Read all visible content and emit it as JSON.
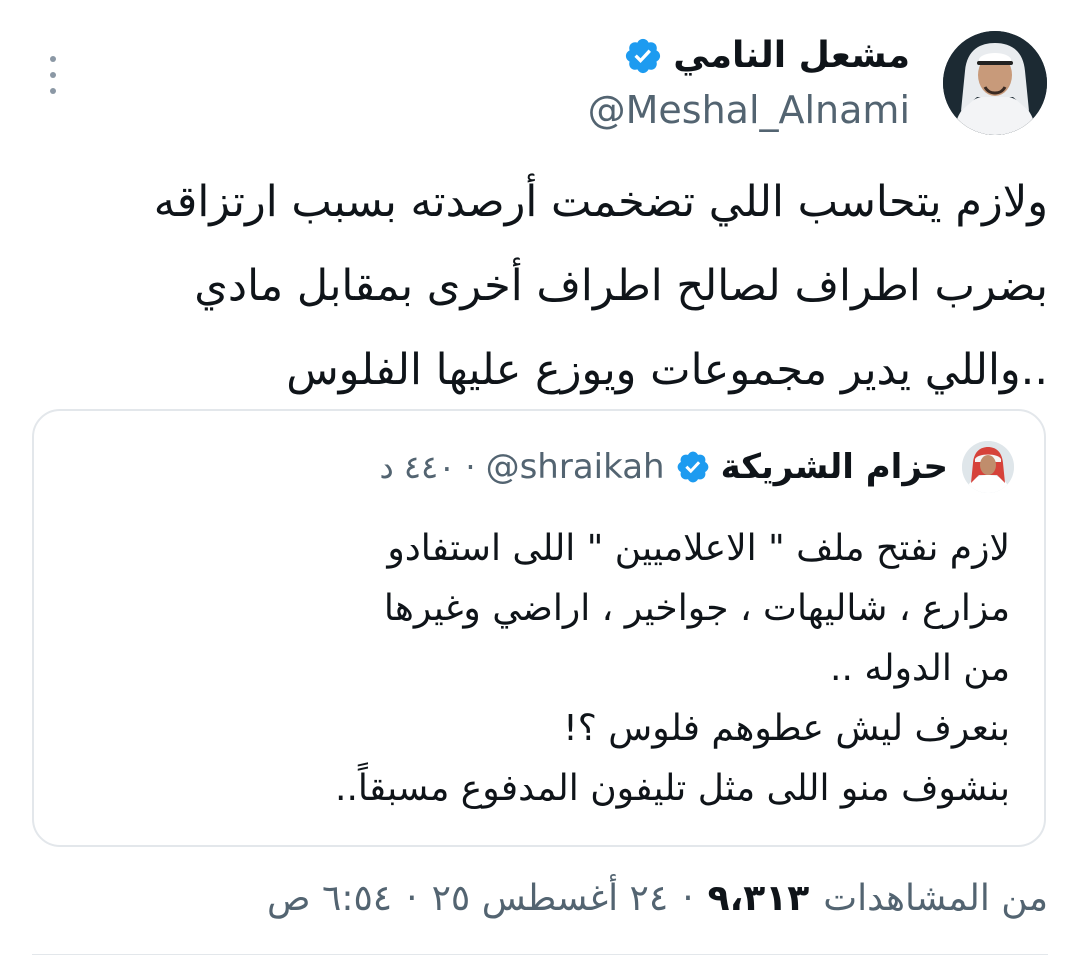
{
  "author": {
    "display_name": "مشعل النامي",
    "handle": "@Meshal_Alnami",
    "verified": true,
    "avatar_icon": "user-avatar"
  },
  "tweet": {
    "lines": [
      "ولازم يتحاسب اللي تضخمت أرصدته بسبب ارتزاقه",
      "بضرب اطراف لصالح اطراف أخرى بمقابل مادي",
      "..واللي يدير مجموعات ويوزع عليها الفلوس"
    ]
  },
  "quoted_tweet": {
    "display_name": "حزام الشريكة",
    "handle": "@shraikah",
    "separator": "·",
    "time": "٤٤٠ د",
    "verified": true,
    "lines": [
      "لازم نفتح ملف \" الاعلاميين \" اللى استفادو",
      "مزارع ، شاليهات ، جواخير ، اراضي وغيرها",
      "من الدوله ..",
      "بنعرف ليش عطوهم فلوس ؟!",
      "بنشوف منو اللى مثل تليفون المدفوع مسبقاً.."
    ]
  },
  "meta": {
    "time": "٦:٥٤ ص",
    "date": "٢٤ أغسطس ٢٥",
    "views_count": "٩،٣١٣",
    "views_label": "من المشاهدات",
    "separator": "·"
  },
  "colors": {
    "text": "#0f1419",
    "secondary": "#536471",
    "verified": "#1d9bf0",
    "border": "#e3e7eb"
  }
}
